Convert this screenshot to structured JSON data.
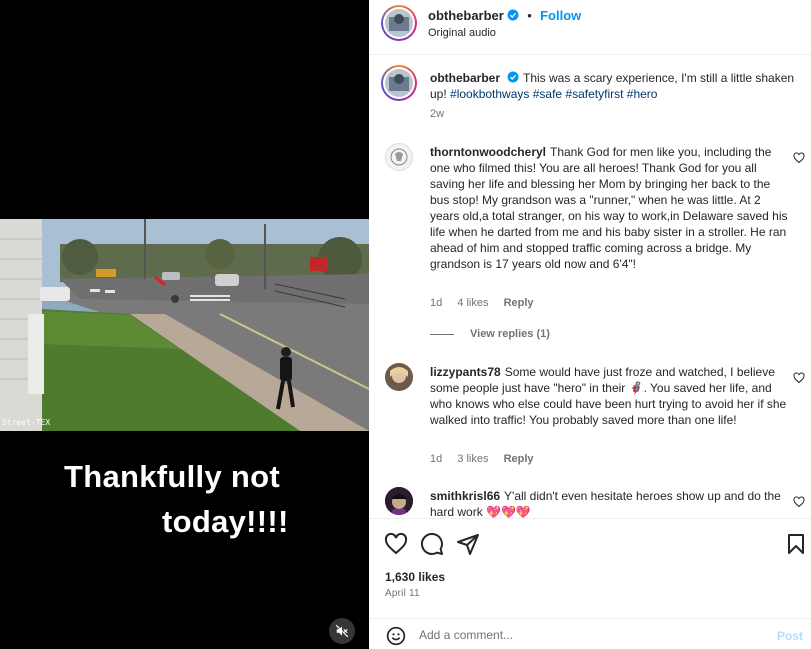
{
  "media": {
    "caption_line1": "Thankfully not",
    "caption_line2": "today!!!!",
    "watermark": "Street-TEX",
    "mute_icon": "speaker-muted-icon"
  },
  "post": {
    "username": "obthebarber",
    "follow_label": "Follow",
    "separator": "•",
    "audio": "Original audio",
    "caption_text": "This was a scary experience, I'm still a little shaken up! ",
    "hashtags": "#lookbothways #safe #safetyfirst #hero",
    "caption_time": "2w"
  },
  "comments": [
    {
      "username": "thorntonwoodcheryl",
      "text": "Thank God for men like you, including the one who filmed this! You are all heroes! Thank God for you all saving her life and blessing her Mom by bringing her back to the bus stop! My grandson was a \"runner,\" when he was little. At 2 years old,a total stranger, on his way to work,in Delaware saved his life when he darted from me and his baby sister in a stroller. He ran ahead of him and stopped traffic coming across a bridge. My grandson is 17 years old now and 6'4\"!",
      "time": "1d",
      "likes": "4 likes",
      "reply": "Reply",
      "view_replies": "View replies (1)"
    },
    {
      "username": "lizzypants78",
      "text": "Some would have just froze and watched, I believe some people just have \"hero\" in their 🦸. You saved her life, and who knows who else could have been hurt trying to avoid her if she walked into traffic! You probably saved more than one life!",
      "time": "1d",
      "likes": "3 likes",
      "reply": "Reply"
    },
    {
      "username": "smithkrisl66",
      "text": "Y'all didn't even hesitate heroes show up and do the hard work 💖💖💖"
    }
  ],
  "actions": {
    "likes": "1,630 likes",
    "date": "April 11"
  },
  "add_comment": {
    "placeholder": "Add a comment...",
    "post_label": "Post"
  },
  "colors": {
    "accent": "#0095f6",
    "hashtag": "#00376b",
    "muted": "#737373"
  }
}
